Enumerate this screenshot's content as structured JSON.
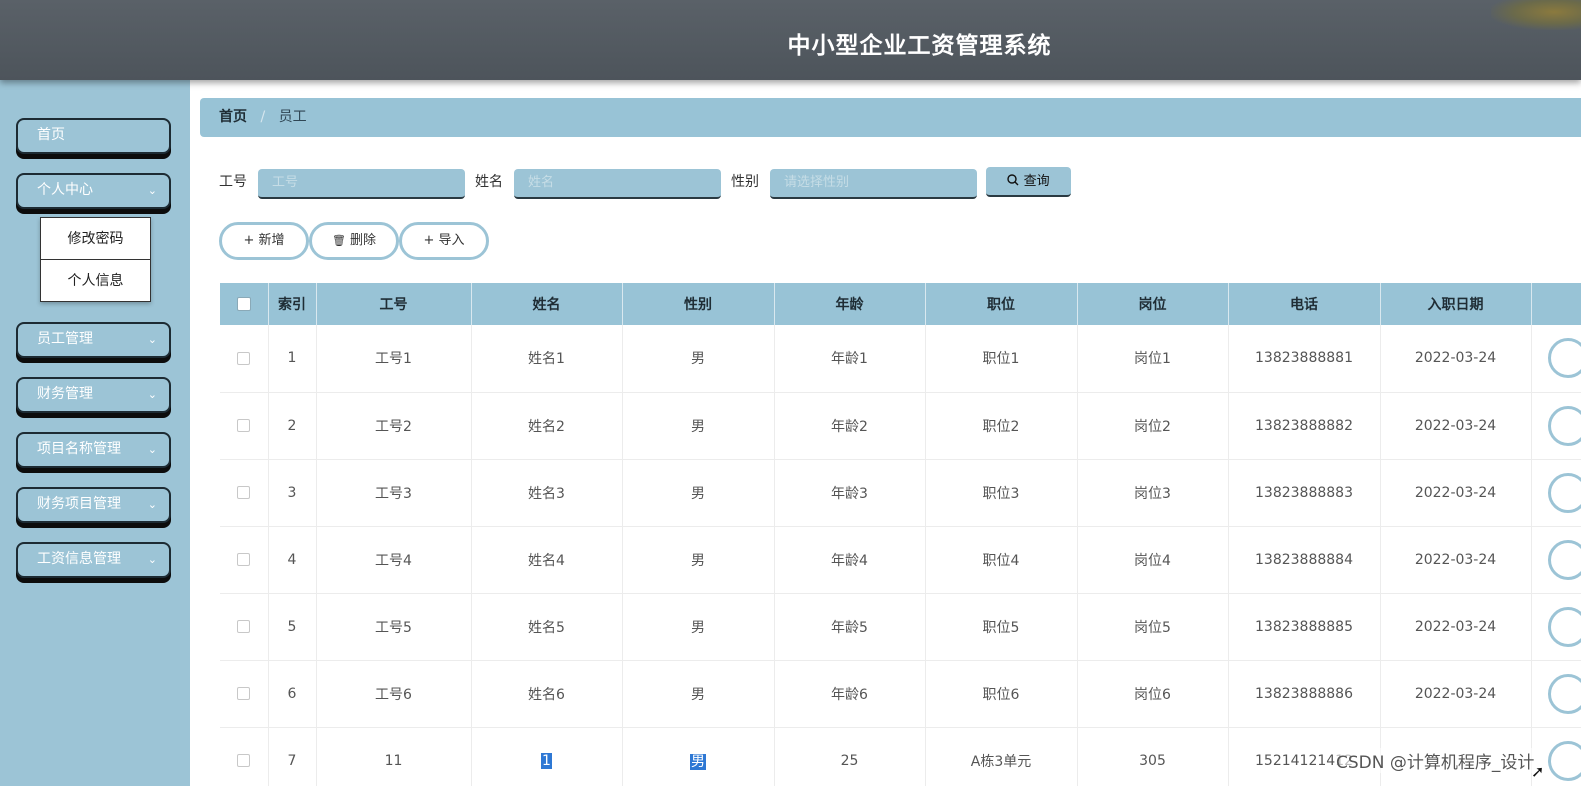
{
  "header": {
    "title": "中小型企业工资管理系统"
  },
  "sidebar": {
    "items": [
      {
        "label": "首页",
        "has_chevron": false
      },
      {
        "label": "个人中心",
        "has_chevron": true
      },
      {
        "label": "员工管理",
        "has_chevron": true
      },
      {
        "label": "财务管理",
        "has_chevron": true
      },
      {
        "label": "项目名称管理",
        "has_chevron": true
      },
      {
        "label": "财务项目管理",
        "has_chevron": true
      },
      {
        "label": "工资信息管理",
        "has_chevron": true
      }
    ],
    "chevron_glyph": "⌄",
    "submenu": [
      "修改密码",
      "个人信息"
    ]
  },
  "breadcrumb": {
    "home": "首页",
    "separator": "/",
    "current": "员工"
  },
  "search": {
    "fields": [
      {
        "label": "工号",
        "placeholder": "工号"
      },
      {
        "label": "姓名",
        "placeholder": "姓名"
      },
      {
        "label": "性别",
        "placeholder": "请选择性别"
      }
    ],
    "query_label": "查询",
    "query_icon": "search-icon"
  },
  "actions": [
    {
      "label": "新增",
      "icon": "+"
    },
    {
      "label": "删除",
      "icon": "🗑"
    },
    {
      "label": "导入",
      "icon": "+"
    }
  ],
  "table": {
    "columns": [
      "索引",
      "工号",
      "姓名",
      "性别",
      "年龄",
      "职位",
      "岗位",
      "电话",
      "入职日期"
    ],
    "rows": [
      [
        "1",
        "工号1",
        "姓名1",
        "男",
        "年龄1",
        "职位1",
        "岗位1",
        "13823888881",
        "2022-03-24"
      ],
      [
        "2",
        "工号2",
        "姓名2",
        "男",
        "年龄2",
        "职位2",
        "岗位2",
        "13823888882",
        "2022-03-24"
      ],
      [
        "3",
        "工号3",
        "姓名3",
        "男",
        "年龄3",
        "职位3",
        "岗位3",
        "13823888883",
        "2022-03-24"
      ],
      [
        "4",
        "工号4",
        "姓名4",
        "男",
        "年龄4",
        "职位4",
        "岗位4",
        "13823888884",
        "2022-03-24"
      ],
      [
        "5",
        "工号5",
        "姓名5",
        "男",
        "年龄5",
        "职位5",
        "岗位5",
        "13823888885",
        "2022-03-24"
      ],
      [
        "6",
        "工号6",
        "姓名6",
        "男",
        "年龄6",
        "职位6",
        "岗位6",
        "13823888886",
        "2022-03-24"
      ],
      [
        "7",
        "11",
        "1",
        "男",
        "25",
        "A栋3单元",
        "305",
        "15214121412",
        ""
      ]
    ],
    "highlighted_row": 7
  },
  "watermark": "CSDN @计算机程序_设计",
  "colors": {
    "accent": "#9cc4d6",
    "header": "#50575e",
    "selection": "#2e78d4"
  }
}
